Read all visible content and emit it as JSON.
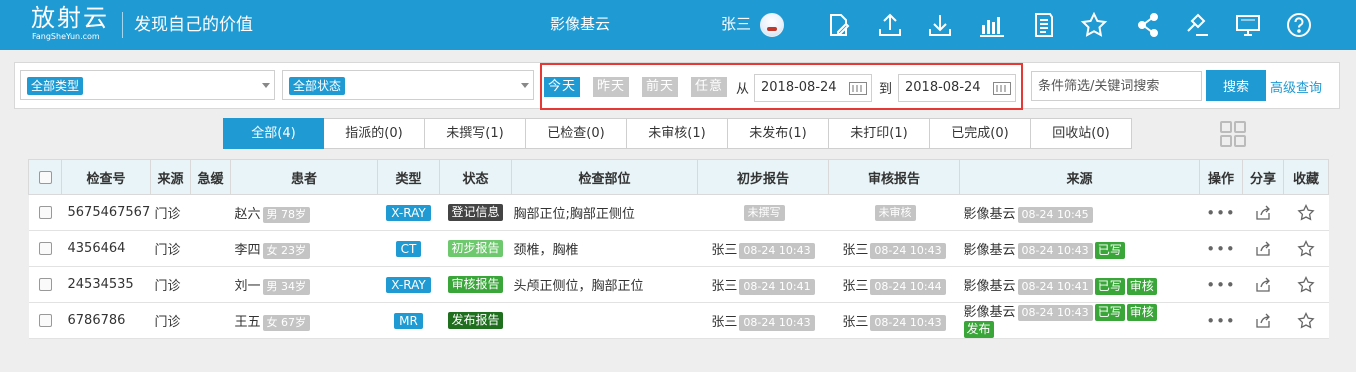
{
  "header": {
    "logo_cn": "放射云",
    "logo_en": "FangSheYun.com",
    "slogan": "发现自己的价值",
    "app_title": "影像基云",
    "user_name": "张三",
    "icons": [
      "edit-icon",
      "upload-icon",
      "download-icon",
      "statistics-icon",
      "document-icon",
      "star-icon",
      "share-icon",
      "gavel-icon",
      "monitor-icon",
      "help-icon"
    ]
  },
  "filters": {
    "type_select": "全部类型",
    "status_select": "全部状态",
    "day_buttons": [
      "今天",
      "昨天",
      "前天",
      "任意"
    ],
    "from_label": "从",
    "to_label": "到",
    "date_from": "2018-08-24",
    "date_to": "2018-08-24",
    "search_placeholder": "条件筛选/关键词搜索",
    "search_button": "搜索",
    "advanced_link": "高级查询"
  },
  "tabs": [
    "全部(4)",
    "指派的(0)",
    "未撰写(1)",
    "已检查(0)",
    "未审核(1)",
    "未发布(1)",
    "未打印(1)",
    "已完成(0)",
    "回收站(0)"
  ],
  "table": {
    "columns": [
      "检查号",
      "来源",
      "急缓",
      "患者",
      "类型",
      "状态",
      "检查部位",
      "初步报告",
      "审核报告",
      "来源",
      "操作",
      "分享",
      "收藏"
    ],
    "rows": [
      {
        "id": "5675467567",
        "source": "门诊",
        "urgency": "",
        "patient": "赵六",
        "patient_info": "男 78岁",
        "type": "X-RAY",
        "status": "登记信息",
        "part": "胸部正位;胸部正侧位",
        "pre_name": "",
        "pre_time": "未撰写",
        "audit_name": "",
        "audit_time": "未审核",
        "org": "影像基云",
        "org_time": "08-24 10:45",
        "tag1": "",
        "tag2": "",
        "tag3": "",
        "ops": "•••"
      },
      {
        "id": "4356464",
        "source": "门诊",
        "urgency": "",
        "patient": "李四",
        "patient_info": "女 23岁",
        "type": "CT",
        "status": "初步报告",
        "part": "颈椎，胸椎",
        "pre_name": "张三",
        "pre_time": "08-24 10:43",
        "audit_name": "张三",
        "audit_time": "08-24 10:43",
        "org": "影像基云",
        "org_time": "08-24 10:43",
        "tag1": "已写",
        "tag2": "",
        "tag3": "",
        "ops": "•••"
      },
      {
        "id": "24534535",
        "source": "门诊",
        "urgency": "",
        "patient": "刘一",
        "patient_info": "男 34岁",
        "type": "X-RAY",
        "status": "审核报告",
        "part": "头颅正侧位，胸部正位",
        "pre_name": "张三",
        "pre_time": "08-24 10:41",
        "audit_name": "张三",
        "audit_time": "08-24 10:44",
        "org": "影像基云",
        "org_time": "08-24 10:41",
        "tag1": "已写",
        "tag2": "审核",
        "tag3": "",
        "ops": "•••"
      },
      {
        "id": "6786786",
        "source": "门诊",
        "urgency": "",
        "patient": "王五",
        "patient_info": "女 67岁",
        "type": "MR",
        "status": "发布报告",
        "part": "",
        "pre_name": "张三",
        "pre_time": "08-24 10:43",
        "audit_name": "张三",
        "audit_time": "08-24 10:43",
        "org": "影像基云",
        "org_time": "08-24 10:43",
        "tag1": "已写",
        "tag2": "审核",
        "tag3": "发布",
        "ops": "•••"
      }
    ]
  }
}
